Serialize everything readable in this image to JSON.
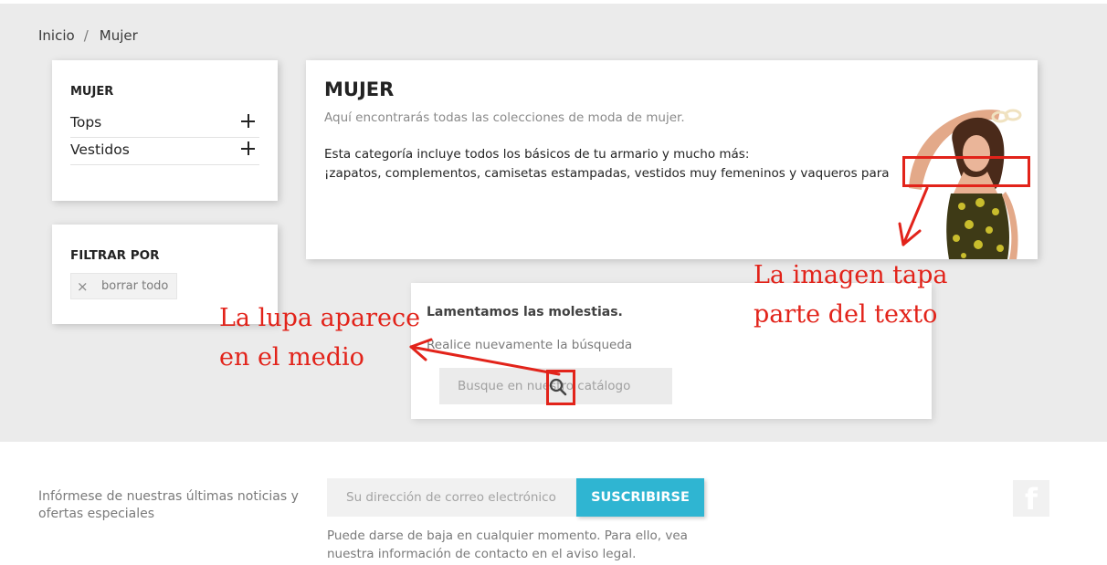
{
  "breadcrumb": {
    "home": "Inicio",
    "separator": "/",
    "current": "Mujer"
  },
  "categories": {
    "title": "MUJER",
    "items": [
      {
        "label": "Tops"
      },
      {
        "label": "Vestidos"
      }
    ]
  },
  "filters": {
    "title": "FILTRAR POR",
    "clear_label": "borrar todo",
    "clear_icon": "×"
  },
  "category_description": {
    "title": "MUJER",
    "subtitle": "Aquí encontrarás todas las colecciones de moda de mujer.",
    "line1": "Esta categoría incluye todos los básicos de tu armario y mucho más:",
    "line2": "¡zapatos, complementos, camisetas estampadas, vestidos muy femeninos y vaqueros para"
  },
  "no_results": {
    "title": "Lamentamos las molestias.",
    "subtitle": "Realice nuevamente la búsqueda",
    "search_placeholder": "Busque en nuestro catálogo",
    "search_icon": "magnifier-icon"
  },
  "annotations": {
    "image_note_line1": "La imagen tapa",
    "image_note_line2": "parte del texto",
    "lupa_note_line1": "La lupa aparece",
    "lupa_note_line2": "en el medio",
    "color": "#e2231a"
  },
  "newsletter": {
    "text": "Infórmese de nuestras últimas noticias y ofertas especiales",
    "email_placeholder": "Su dirección de correo electrónico",
    "subscribe_label": "SUSCRIBIRSE",
    "note": "Puede darse de baja en cualquier momento. Para ello, vea nuestra información de contacto en el aviso legal.",
    "accent_color": "#2fb5d2"
  },
  "social": {
    "facebook_glyph": "f",
    "icon": "facebook-icon"
  }
}
